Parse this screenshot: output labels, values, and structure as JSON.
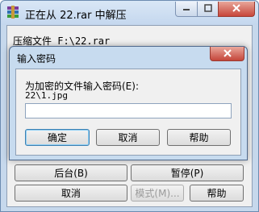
{
  "outer_window": {
    "title": "正在从 22.rar 中解压",
    "compress_file_label": "压缩文件 F:\\22.rar",
    "buttons": {
      "background": "后台(B)",
      "pause": "暂停(P)",
      "cancel": "取消",
      "mode": "模式(M)...",
      "help": "帮助"
    }
  },
  "dialog": {
    "title": "输入密码",
    "prompt": "为加密的文件输入密码(E):",
    "file_path": "22\\1.jpg",
    "password_value": "",
    "buttons": {
      "ok": "确定",
      "cancel": "取消",
      "help": "帮助"
    }
  },
  "colors": {
    "frame": "#c6d8ec",
    "close_red": "#c7463a",
    "client_bg": "#f0f0f0"
  }
}
